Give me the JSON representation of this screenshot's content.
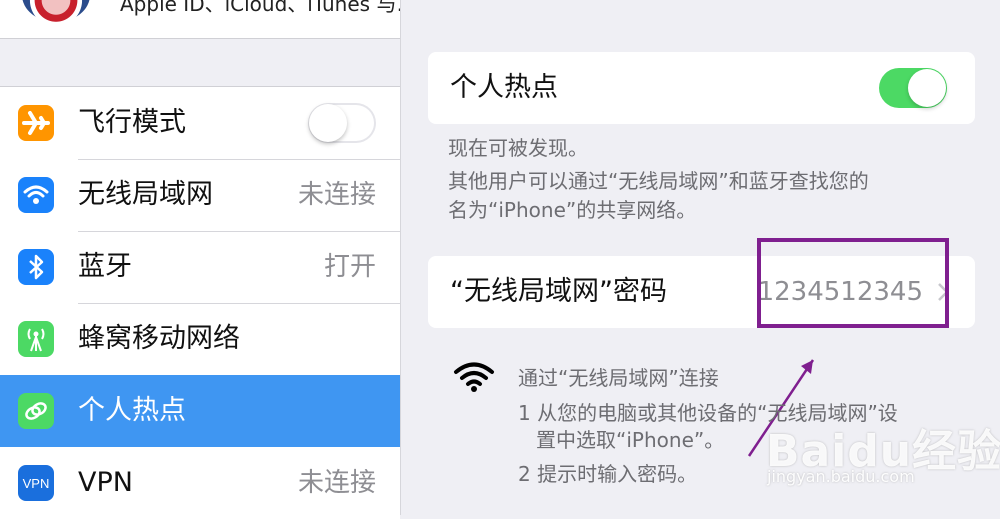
{
  "sidebar": {
    "account_text": "Apple ID、iCloud、iTunes 与…",
    "items": [
      {
        "label": "飞行模式",
        "value": "",
        "icon": "airplane-icon",
        "color": "#ff9500"
      },
      {
        "label": "无线局域网",
        "value": "未连接",
        "icon": "wifi-icon",
        "color": "#1a82fb"
      },
      {
        "label": "蓝牙",
        "value": "打开",
        "icon": "bluetooth-icon",
        "color": "#1a82fb"
      },
      {
        "label": "蜂窝移动网络",
        "value": "",
        "icon": "cellular-icon",
        "color": "#4cd964"
      },
      {
        "label": "个人热点",
        "value": "",
        "icon": "hotspot-icon",
        "color": "#4cd964"
      },
      {
        "label": "VPN",
        "value": "未连接",
        "icon": "vpn-icon",
        "color": "#1a6fdd"
      }
    ],
    "selected_color": "#3f96f2"
  },
  "detail": {
    "hotspot_title": "个人热点",
    "hotspot_on": true,
    "desc_line1": "现在可被发现。",
    "desc_line2": "其他用户可以通过“无线局域网”和蓝牙查找您的",
    "desc_line3": "名为“iPhone”的共享网络。",
    "password_label": "“无线局域网”密码",
    "password_value": "1234512345",
    "instructions": {
      "heading": "通过“无线局域网”连接",
      "step1_line1": "1 从您的电脑或其他设备的“无线局域网”设",
      "step1_line2": "置中选取“iPhone”。",
      "step2": "2 提示时输入密码。"
    }
  },
  "watermark": {
    "main": "Baidu经验",
    "sub": "jingyan.baidu.com"
  },
  "colors": {
    "toggle_on": "#4cd964",
    "highlight_box": "#7f1f8f"
  }
}
